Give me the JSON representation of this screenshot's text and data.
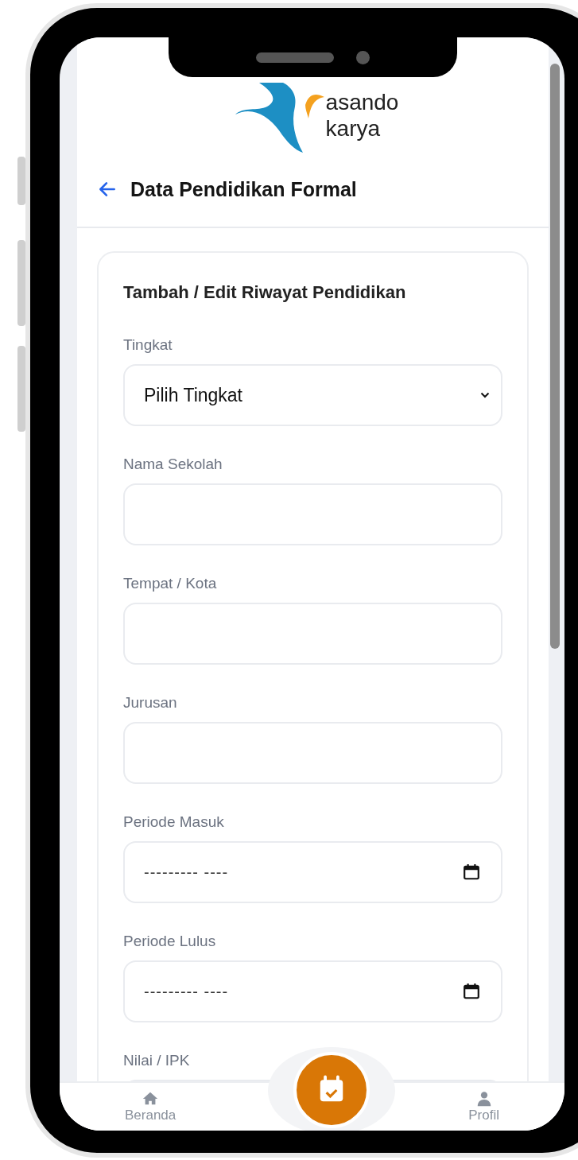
{
  "logo": {
    "line_1": "asando",
    "line_2": "karya"
  },
  "header": {
    "title": "Data Pendidikan Formal"
  },
  "form": {
    "title": "Tambah / Edit Riwayat Pendidikan",
    "fields": [
      {
        "kind": "select",
        "label": "Tingkat",
        "value": "Pilih Tingkat"
      },
      {
        "kind": "text",
        "label": "Nama Sekolah"
      },
      {
        "kind": "text",
        "label": "Tempat / Kota"
      },
      {
        "kind": "text",
        "label": "Jurusan"
      },
      {
        "kind": "date",
        "label": "Periode Masuk",
        "value": "--------- ----"
      },
      {
        "kind": "date",
        "label": "Periode Lulus",
        "value": "--------- ----"
      },
      {
        "kind": "text",
        "label": "Nilai / IPK"
      }
    ]
  },
  "bottom_nav": {
    "items": [
      {
        "kind": "home",
        "label": "Beranda"
      },
      {
        "kind": "profile",
        "label": "Profil"
      }
    ]
  }
}
